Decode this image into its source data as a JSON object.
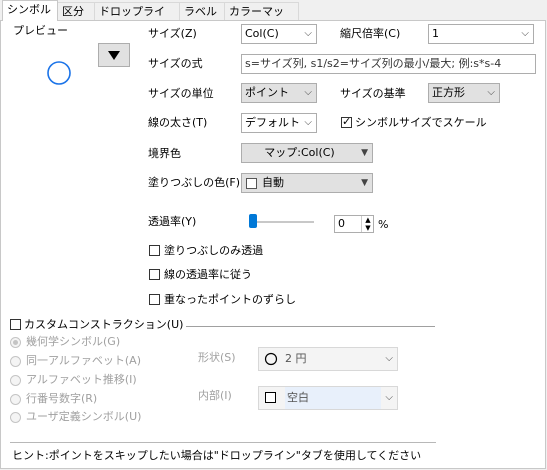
{
  "tabs": [
    "シンボル",
    "区分",
    "ドロップライン",
    "ラベル",
    "カラーマップ"
  ],
  "preview": {
    "label": "プレビュー"
  },
  "size": {
    "label": "サイズ(Z)",
    "value": "Col(C)"
  },
  "scale": {
    "label": "縮尺倍率(C)",
    "value": "1"
  },
  "size_formula": {
    "label": "サイズの式",
    "placeholder": "s=サイズ列, s1/s2=サイズ列の最小/最大; 例:s*s-4"
  },
  "size_unit": {
    "label": "サイズの単位",
    "value": "ポイント"
  },
  "size_basis": {
    "label": "サイズの基準",
    "value": "正方形"
  },
  "line_width": {
    "label": "線の太さ(T)",
    "value": "デフォルト"
  },
  "scale_with_symbol": {
    "label": "シンボルサイズでスケール",
    "checked": true
  },
  "edge_color": {
    "label": "境界色",
    "value": "マップ:Col(C)"
  },
  "fill_color": {
    "label": "塗りつぶしの色(F)",
    "value": "自動"
  },
  "transparency": {
    "label": "透過率(Y)",
    "value": "0",
    "unit": "%"
  },
  "fill_only_transparent": {
    "label": "塗りつぶしのみ透過",
    "checked": false
  },
  "follow_line_transparency": {
    "label": "線の透過率に従う",
    "checked": false
  },
  "offset_overlap": {
    "label": "重なったポイントのずらし",
    "checked": false
  },
  "custom_construction": {
    "label": "カスタムコンストラクション(U)",
    "checked": false,
    "options": [
      "幾何学シンボル(G)",
      "同一アルファベット(A)",
      "アルファベット推移(I)",
      "行番号数字(R)",
      "ユーザ定義シンボル(U)"
    ],
    "shape": {
      "label": "形状(S)",
      "value": "2 円"
    },
    "interior": {
      "label": "内部(I)",
      "value": "空白"
    }
  },
  "hint": "ヒント:ポイントをスキップしたい場合は\"ドロップライン\"タブを使用してください",
  "colors": {
    "accent": "#1a73e8",
    "slider": "#0078d7"
  }
}
